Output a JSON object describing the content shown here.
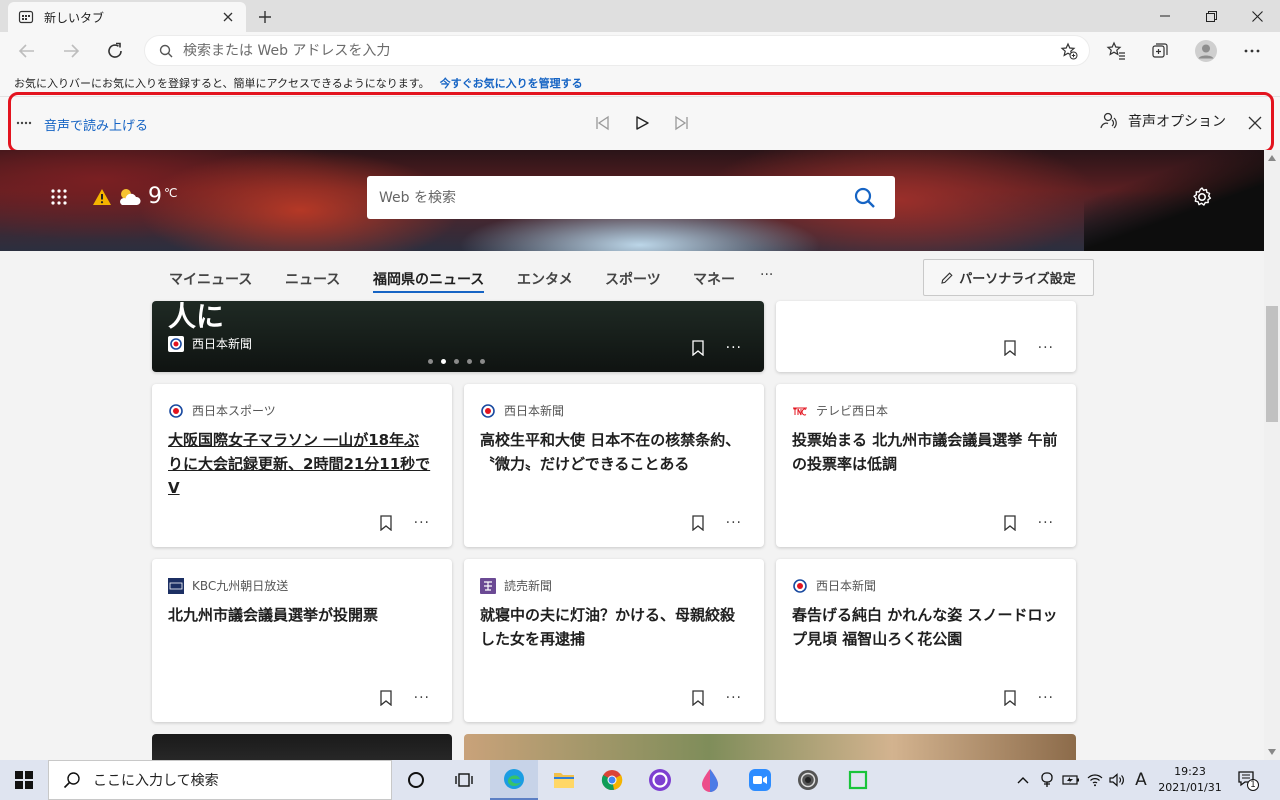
{
  "tab": {
    "title": "新しいタブ"
  },
  "toolbar": {
    "address_placeholder": "検索または Web アドレスを入力"
  },
  "favorites_bar": {
    "message": "お気に入りバーにお気に入りを登録すると、簡単にアクセスできるようになります。",
    "link": "今すぐお気に入りを管理する"
  },
  "read_aloud": {
    "label": "音声で読み上げる",
    "options": "音声オプション"
  },
  "hero": {
    "temperature": "9",
    "unit": "℃",
    "search_placeholder": "Web を検索"
  },
  "nav": {
    "tabs": [
      "マイニュース",
      "ニュース",
      "福岡県のニュース",
      "エンタメ",
      "スポーツ",
      "マネー"
    ],
    "active_index": 2,
    "more": "···",
    "personalize": "パーソナライズ設定"
  },
  "featured": {
    "headline_fragment": "人に",
    "source": "西日本新聞",
    "carousel_total": 5,
    "carousel_active": 1
  },
  "cards": [
    {
      "source": "西日本スポーツ",
      "logo": "nishinippon-logo",
      "headline": "大阪国際女子マラソン 一山が18年ぶりに大会記録更新、2時間21分11秒でV"
    },
    {
      "source": "西日本新聞",
      "logo": "nishinippon-logo",
      "headline": "高校生平和大使 日本不在の核禁条約、〝微力〟だけどできることある"
    },
    {
      "source": "テレビ西日本",
      "logo": "tnc-logo",
      "headline": "投票始まる 北九州市議会議員選挙 午前の投票率は低調"
    },
    {
      "source": "KBC九州朝日放送",
      "logo": "kbc-logo",
      "headline": "北九州市議会議員選挙が投開票"
    },
    {
      "source": "読売新聞",
      "logo": "yomiuri-logo",
      "headline": "就寝中の夫に灯油？かける、母親絞殺した女を再逮捕"
    },
    {
      "source": "西日本新聞",
      "logo": "nishinippon-logo",
      "headline": "春告げる純白 かれんな姿 スノードロップ見頃 福智山ろく花公園"
    }
  ],
  "card_more": "···",
  "taskbar": {
    "search_placeholder": "ここに入力して検索",
    "ime": "A",
    "time": "19:23",
    "date": "2021/01/31",
    "notifications": "1"
  },
  "colors": {
    "accent": "#1664c4",
    "highlight_border": "#e3141f",
    "taskbar": "#dfe4f0"
  }
}
